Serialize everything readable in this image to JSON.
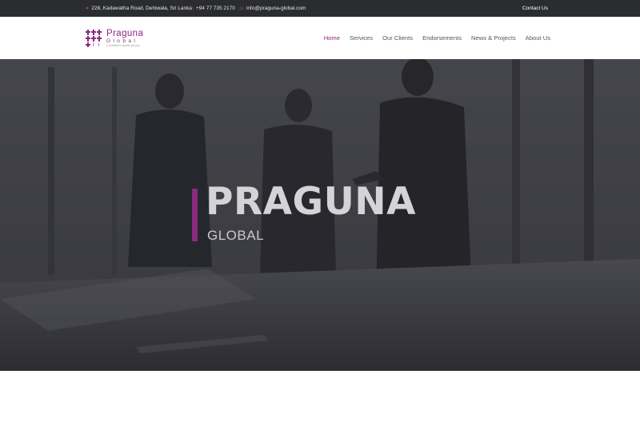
{
  "topbar": {
    "address": "228, Kadawatha Road, Dehiwala, Sri Lanka",
    "phone": "+94 77 735 2170",
    "email": "info@praguna-global.com",
    "contact_us": "Contact Us"
  },
  "logo": {
    "name": "Praguna",
    "sub": "Global",
    "tagline": "Committed to quality and you."
  },
  "nav": {
    "items": [
      {
        "label": "Home",
        "active": true
      },
      {
        "label": "Services"
      },
      {
        "label": "Our Clients"
      },
      {
        "label": "Endorsements"
      },
      {
        "label": "News & Projects"
      },
      {
        "label": "About Us"
      }
    ]
  },
  "hero": {
    "title": "PRAGUNA",
    "subtitle": "GLOBAL"
  },
  "colors": {
    "accent": "#8a2a7f",
    "topbar": "#2b2c30"
  },
  "icons": {
    "address": "map-pin-icon",
    "phone": "phone-icon",
    "email": "mail-icon"
  }
}
